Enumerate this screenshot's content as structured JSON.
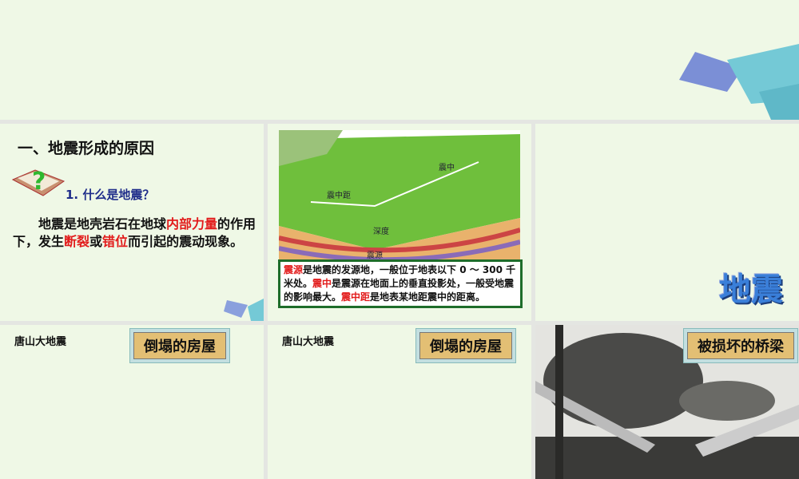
{
  "slide2": {
    "title": "一、地震形成的原因",
    "question": "1. 什么是地震？",
    "para": [
      {
        "t": "地震是地壳岩石在地球"
      },
      {
        "t": "内部力量",
        "red": true
      },
      {
        "t": "的作用下，发生"
      },
      {
        "t": "断裂",
        "red": true
      },
      {
        "t": "或"
      },
      {
        "t": "错位",
        "red": true
      },
      {
        "t": "而引起的震动现象。"
      }
    ]
  },
  "slide3": {
    "map_labels": [
      "震中距",
      "震中",
      "震源",
      "深度"
    ],
    "info": [
      {
        "t": "震源",
        "red": true
      },
      {
        "t": "是地震的发源地，一般位于地表以下 0 ～ 300 千米处。"
      },
      {
        "t": "震中",
        "red": true
      },
      {
        "t": "是震源在地面上的垂直投影处，一般受地震的影响最大。"
      },
      {
        "t": "震中距",
        "red": true
      },
      {
        "t": "是地表某地距震中的距离。"
      }
    ]
  },
  "slide4": {
    "logo_text": "地震"
  },
  "slide5": {
    "caption": "唐山大地震",
    "tag": "倒塌的房屋"
  },
  "slide6": {
    "caption": "唐山大地震",
    "tag": "倒塌的房屋"
  },
  "slide7": {
    "tag": "被损坏的桥梁"
  }
}
